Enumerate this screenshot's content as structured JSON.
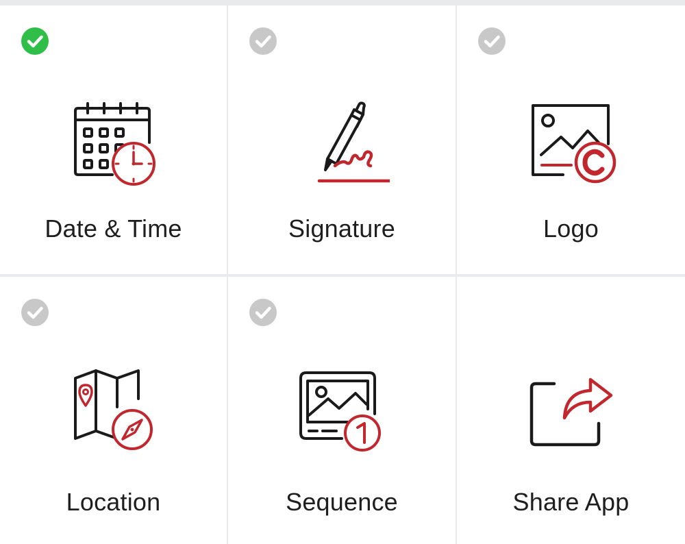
{
  "tiles": [
    {
      "label": "Date & Time",
      "icon": "calendar-clock-icon",
      "status": "selected"
    },
    {
      "label": "Signature",
      "icon": "pen-signature-icon",
      "status": "unselected"
    },
    {
      "label": "Logo",
      "icon": "image-copyright-icon",
      "status": "unselected"
    },
    {
      "label": "Location",
      "icon": "map-compass-icon",
      "status": "unselected"
    },
    {
      "label": "Sequence",
      "icon": "image-number-icon",
      "status": "unselected"
    },
    {
      "label": "Share App",
      "icon": "share-icon"
    }
  ],
  "colors": {
    "selected_check": "#2fbf48",
    "unselected_check": "#c8c8c8",
    "icon_accent": "#c1272d",
    "icon_line": "#1a1a1a"
  }
}
